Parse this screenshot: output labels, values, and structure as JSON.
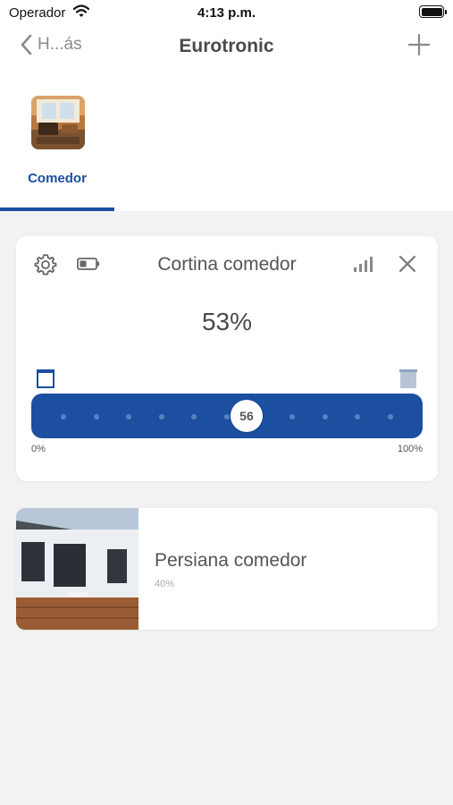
{
  "status_bar": {
    "carrier": "Operador",
    "time": "4:13 p.m."
  },
  "nav": {
    "back_label": "H...ás",
    "title": "Eurotronic"
  },
  "rooms": [
    {
      "label": "Comedor",
      "selected": true
    }
  ],
  "device_control": {
    "title": "Cortina comedor",
    "percent": "53%",
    "slider_value": "56",
    "slider_fraction": 0.56,
    "scale_min": "0%",
    "scale_max": "100%"
  },
  "devices": [
    {
      "name": "Persiana comedor",
      "subtitle": "40%"
    }
  ],
  "colors": {
    "accent": "#1c4fa0",
    "background": "#f2f2f2"
  }
}
